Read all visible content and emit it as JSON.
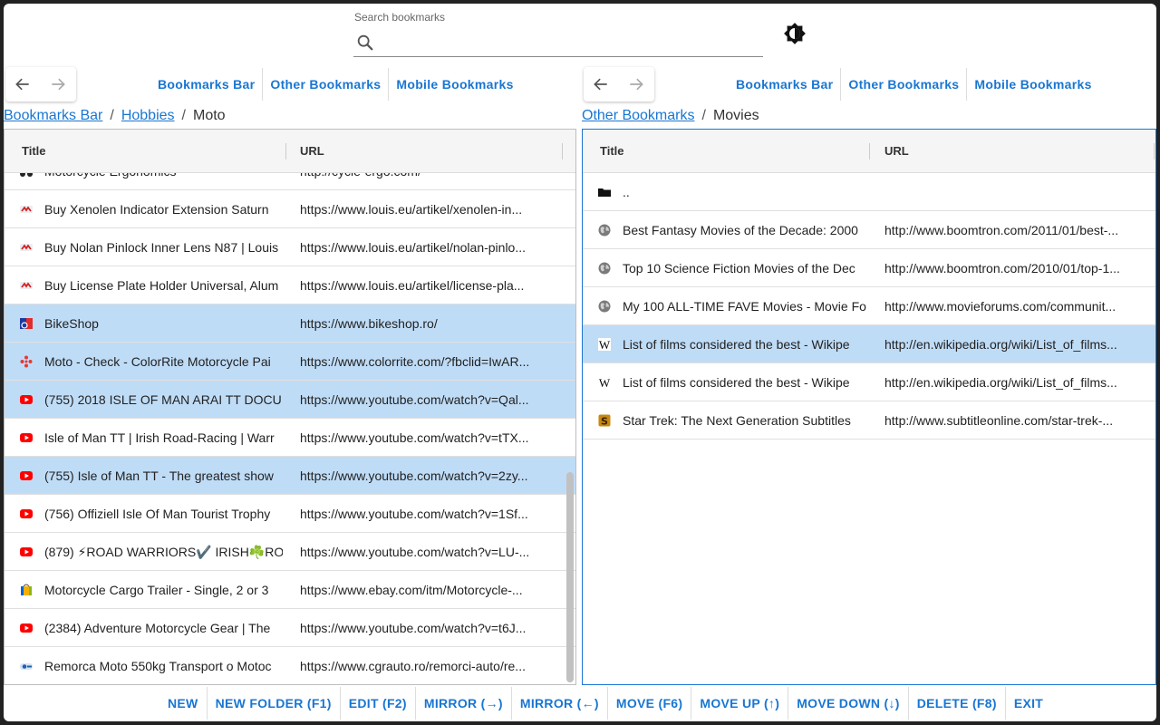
{
  "search": {
    "label": "Search bookmarks",
    "value": ""
  },
  "left": {
    "roots": [
      "Bookmarks Bar",
      "Other Bookmarks",
      "Mobile Bookmarks"
    ],
    "breadcrumb": {
      "links": [
        "Bookmarks Bar",
        "Hobbies"
      ],
      "current": "Moto"
    },
    "columns": {
      "title": "Title",
      "url": "URL"
    },
    "rows": [
      {
        "icon": "moto-ergonomics-icon",
        "title": "Motorcycle Ergonomics",
        "url": "http://cycle-ergo.com/",
        "selected": false
      },
      {
        "icon": "louis-icon",
        "title": "Buy Xenolen Indicator Extension Saturn",
        "url": "https://www.louis.eu/artikel/xenolen-in...",
        "selected": false
      },
      {
        "icon": "louis-icon",
        "title": "Buy Nolan Pinlock Inner Lens N87 | Louis",
        "url": "https://www.louis.eu/artikel/nolan-pinlo...",
        "selected": false
      },
      {
        "icon": "louis-icon",
        "title": "Buy License Plate Holder Universal, Alum",
        "url": "https://www.louis.eu/artikel/license-pla...",
        "selected": false
      },
      {
        "icon": "bikeshop-icon",
        "title": "BikeShop",
        "url": "https://www.bikeshop.ro/",
        "selected": true
      },
      {
        "icon": "colorrite-icon",
        "title": "Moto - Check - ColorRite Motorcycle Pai",
        "url": "https://www.colorrite.com/?fbclid=IwAR...",
        "selected": true
      },
      {
        "icon": "youtube-icon",
        "title": "(755) 2018 ISLE OF MAN ARAI TT DOCU",
        "url": "https://www.youtube.com/watch?v=Qal...",
        "selected": true
      },
      {
        "icon": "youtube-icon",
        "title": "Isle of Man TT | Irish Road-Racing | Warr",
        "url": "https://www.youtube.com/watch?v=tTX...",
        "selected": false
      },
      {
        "icon": "youtube-icon",
        "title": "(755) Isle of Man TT - The greatest show",
        "url": "https://www.youtube.com/watch?v=2zy...",
        "selected": true
      },
      {
        "icon": "youtube-icon",
        "title": "(756) Offiziell Isle Of Man Tourist Trophy",
        "url": "https://www.youtube.com/watch?v=1Sf...",
        "selected": false
      },
      {
        "icon": "youtube-icon",
        "title": "(879) ⚡ROAD WARRIORS✔️ IRISH☘️RO",
        "url": "https://www.youtube.com/watch?v=LU-...",
        "selected": false
      },
      {
        "icon": "ebay-icon",
        "title": "Motorcycle Cargo Trailer - Single, 2 or 3",
        "url": "https://www.ebay.com/itm/Motorcycle-...",
        "selected": false
      },
      {
        "icon": "youtube-icon",
        "title": "(2384) Adventure Motorcycle Gear | The",
        "url": "https://www.youtube.com/watch?v=t6J...",
        "selected": false
      },
      {
        "icon": "cgrauto-icon",
        "title": "Remorca Moto 550kg Transport o Motoc",
        "url": "https://www.cgrauto.ro/remorci-auto/re...",
        "selected": false
      }
    ]
  },
  "right": {
    "roots": [
      "Bookmarks Bar",
      "Other Bookmarks",
      "Mobile Bookmarks"
    ],
    "breadcrumb": {
      "links": [
        "Other Bookmarks"
      ],
      "current": "Movies"
    },
    "columns": {
      "title": "Title",
      "url": "URL"
    },
    "rows": [
      {
        "icon": "folder-icon",
        "title": "..",
        "url": "",
        "selected": false
      },
      {
        "icon": "globe-icon",
        "title": "Best Fantasy Movies of the Decade: 2000",
        "url": "http://www.boomtron.com/2011/01/best-...",
        "selected": false
      },
      {
        "icon": "globe-icon",
        "title": "Top 10 Science Fiction Movies of the Dec",
        "url": "http://www.boomtron.com/2010/01/top-1...",
        "selected": false
      },
      {
        "icon": "globe-icon",
        "title": "My 100 ALL-TIME FAVE Movies - Movie Fo",
        "url": "http://www.movieforums.com/communit...",
        "selected": false
      },
      {
        "icon": "wikipedia-icon",
        "title": "List of films considered the best - Wikipe",
        "url": "http://en.wikipedia.org/wiki/List_of_films...",
        "selected": true
      },
      {
        "icon": "wikipedia-icon",
        "title": "List of films considered the best - Wikipe",
        "url": "http://en.wikipedia.org/wiki/List_of_films...",
        "selected": false
      },
      {
        "icon": "subtitle-icon",
        "title": "Star Trek: The Next Generation Subtitles",
        "url": "http://www.subtitleonline.com/star-trek-...",
        "selected": false
      }
    ]
  },
  "toolbar": [
    "NEW",
    "NEW FOLDER (F1)",
    "EDIT (F2)",
    "MIRROR (→)",
    "MIRROR (←)",
    "MOVE (F6)",
    "MOVE UP (↑)",
    "MOVE DOWN (↓)",
    "DELETE (F8)",
    "EXIT"
  ],
  "colors": {
    "accent": "#1976d2",
    "selected_row": "#bfdcf7",
    "active_panel_border": "#1976d2"
  }
}
